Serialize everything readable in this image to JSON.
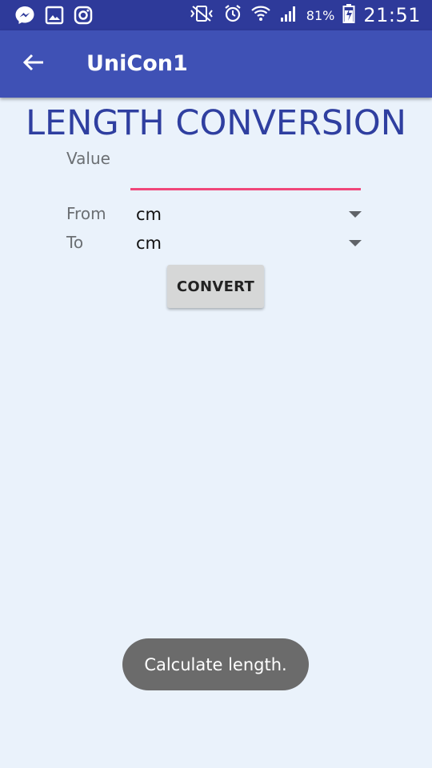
{
  "status_bar": {
    "left_icons": [
      "messenger-icon",
      "gallery-icon",
      "instagram-icon"
    ],
    "right_icons": [
      "vibrate-icon",
      "alarm-icon",
      "wifi-icon",
      "signal-icon",
      "battery-icon"
    ],
    "battery_percent": "81%",
    "time": "21:51"
  },
  "app_bar": {
    "title": "UniCon1",
    "back_icon": "arrow-back-icon"
  },
  "main": {
    "heading": "LENGTH CONVERSION",
    "value_label": "Value",
    "value_input": "",
    "from_label": "From",
    "from_selected": "cm",
    "to_label": "To",
    "to_selected": "cm",
    "convert_label": "CONVERT"
  },
  "toast": {
    "text": "Calculate length."
  },
  "colors": {
    "status_bar": "#2e3a9a",
    "app_bar": "#3f51b5",
    "heading": "#2f3fa0",
    "input_underline": "#f0477a",
    "background": "#eaf2fb"
  }
}
